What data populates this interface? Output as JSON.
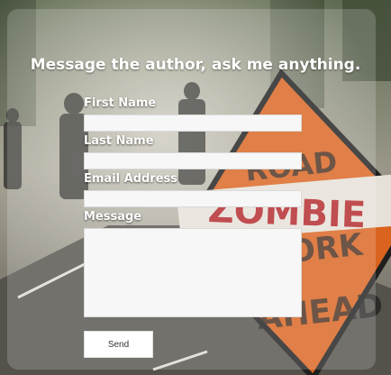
{
  "form": {
    "title": "Message the author, ask me anything.",
    "first_name_label": "First Name",
    "first_name_value": "",
    "last_name_label": "Last Name",
    "last_name_value": "",
    "email_label": "Email Address",
    "email_value": "",
    "message_label": "Message",
    "message_value": "",
    "send_label": "Send"
  },
  "background": {
    "sign_text": [
      "ZOMBIE",
      "ROAD",
      "WORK",
      "AHEAD"
    ],
    "sign_color": "#d9631f",
    "tape_color": "#e6e1d8"
  }
}
